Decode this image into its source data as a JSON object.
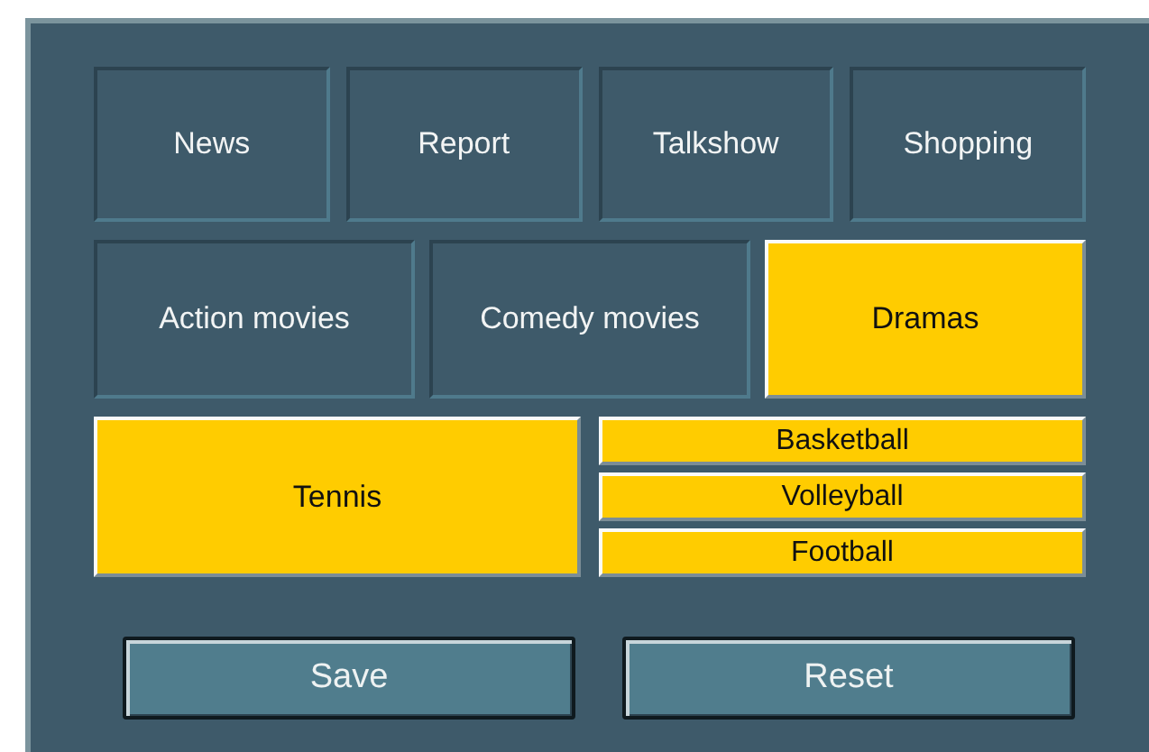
{
  "rows": [
    {
      "items": [
        {
          "kind": "tile",
          "label": "News",
          "selected": false
        },
        {
          "kind": "tile",
          "label": "Report",
          "selected": false
        },
        {
          "kind": "tile",
          "label": "Talkshow",
          "selected": false
        },
        {
          "kind": "tile",
          "label": "Shopping",
          "selected": false
        }
      ]
    },
    {
      "items": [
        {
          "kind": "tile",
          "label": "Action movies",
          "selected": false
        },
        {
          "kind": "tile",
          "label": "Comedy movies",
          "selected": false
        },
        {
          "kind": "tile",
          "label": "Dramas",
          "selected": true
        }
      ]
    },
    {
      "items": [
        {
          "kind": "tile",
          "label": "Tennis",
          "selected": true
        },
        {
          "kind": "stack",
          "items": [
            {
              "label": "Basketball",
              "selected": true
            },
            {
              "label": "Volleyball",
              "selected": true
            },
            {
              "label": "Football",
              "selected": true
            }
          ]
        }
      ]
    }
  ],
  "buttons": [
    "Save",
    "Reset"
  ]
}
